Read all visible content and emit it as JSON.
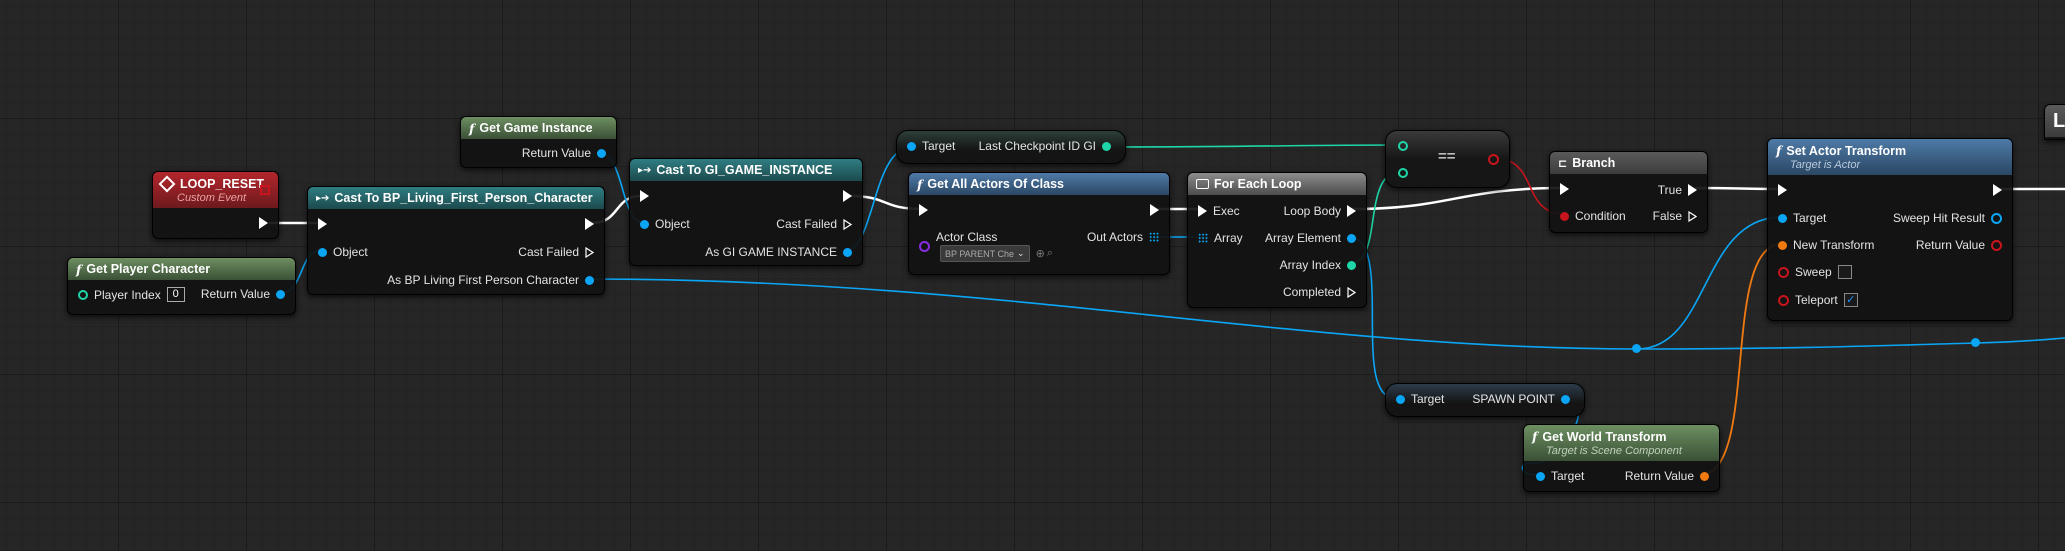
{
  "colors": {
    "exec": "#ffffff",
    "object": "#0aa6f5",
    "integer": "#1ed6a8",
    "transform": "#f07a10",
    "boolean": "#c8141c",
    "class": "#8a2be2"
  },
  "nodes": {
    "loop_reset": {
      "title": "LOOP_RESET",
      "subtitle": "Custom Event",
      "icon": "event-diamond-icon"
    },
    "get_player_character": {
      "title": "Get Player Character",
      "player_index_label": "Player Index",
      "player_index_value": "0",
      "return_label": "Return Value"
    },
    "cast_bp": {
      "title": "Cast To BP_Living_First_Person_Character",
      "object_label": "Object",
      "cast_failed_label": "Cast Failed",
      "as_label": "As BP Living First Person Character"
    },
    "get_game_instance": {
      "title": "Get Game Instance",
      "return_label": "Return Value"
    },
    "cast_gi": {
      "title": "Cast To GI_GAME_INSTANCE",
      "object_label": "Object",
      "cast_failed_label": "Cast Failed",
      "as_label": "As GI GAME INSTANCE"
    },
    "var_last_checkpoint": {
      "target_label": "Target",
      "value_label": "Last Checkpoint ID GI"
    },
    "get_all_actors": {
      "title": "Get All Actors Of Class",
      "actor_class_label": "Actor Class",
      "actor_class_value": "BP PARENT Che",
      "out_actors_label": "Out Actors"
    },
    "for_each": {
      "title": "For Each Loop",
      "exec_label": "Exec",
      "loop_body_label": "Loop Body",
      "array_label": "Array",
      "array_element_label": "Array Element",
      "array_index_label": "Array Index",
      "completed_label": "Completed"
    },
    "equals": {
      "title": "=="
    },
    "branch": {
      "title": "Branch",
      "condition_label": "Condition",
      "true_label": "True",
      "false_label": "False"
    },
    "spawn_point": {
      "target_label": "Target",
      "value_label": "SPAWN POINT"
    },
    "get_world_transform": {
      "title": "Get World Transform",
      "subtitle": "Target is Scene Component",
      "target_label": "Target",
      "return_label": "Return Value"
    },
    "set_actor_transform": {
      "title": "Set Actor Transform",
      "subtitle": "Target is Actor",
      "target_label": "Target",
      "sweep_hit_label": "Sweep Hit Result",
      "new_transform_label": "New Transform",
      "return_label": "Return Value",
      "sweep_label": "Sweep",
      "sweep_checked": false,
      "teleport_label": "Teleport",
      "teleport_checked": true
    },
    "partial_right": {
      "title": "L"
    }
  }
}
